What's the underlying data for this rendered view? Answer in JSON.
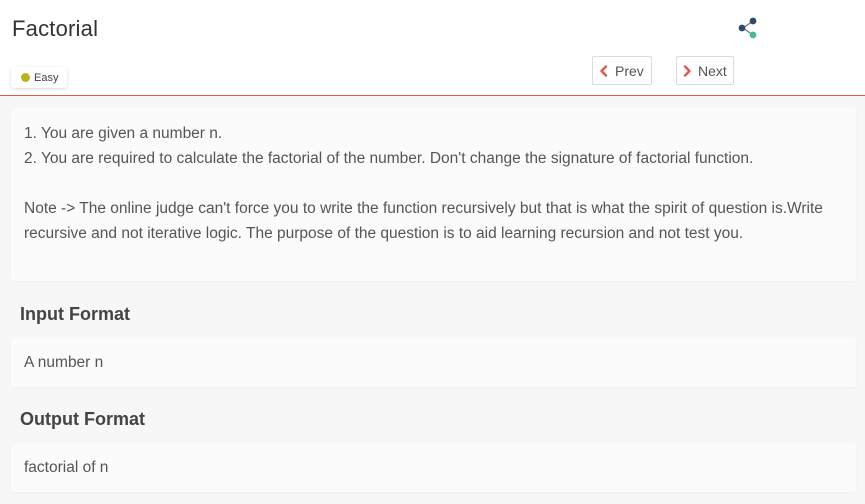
{
  "problem": {
    "title": "Factorial",
    "difficulty": "Easy",
    "difficulty_color": "#b5b51c"
  },
  "nav": {
    "prev_label": "Prev",
    "next_label": "Next",
    "accent_color": "#e2574c"
  },
  "icons": {
    "share": "share-icon",
    "prev": "chevron-left-icon",
    "next": "chevron-right-icon"
  },
  "description": {
    "line1": "1. You are given a number n.",
    "line2": "2. You are required to calculate the factorial of the number. Don't change the signature of factorial function.",
    "note": "Note -> The online judge can't force you to write the function recursively but that is what the spirit of question is.Write recursive and not iterative logic. The purpose of the question is to aid learning recursion and not test you."
  },
  "input_format": {
    "heading": "Input Format",
    "text": "A number n"
  },
  "output_format": {
    "heading": "Output Format",
    "text": "factorial of n"
  }
}
